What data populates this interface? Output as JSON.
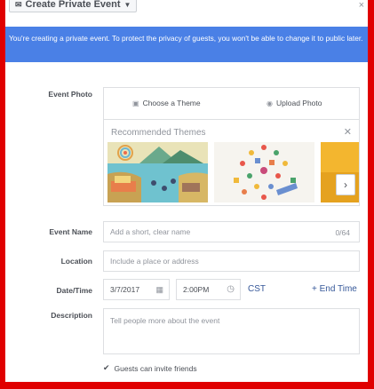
{
  "header": {
    "title": "Create Private Event",
    "title_icon": "envelope-icon",
    "dropdown_icon": "caret-down-icon",
    "close_glyph": "×"
  },
  "notice": {
    "text": "You're creating a private event. To protect the privacy of guests, you won't be able to change it to public later."
  },
  "event_photo": {
    "label": "Event Photo",
    "choose_theme": "Choose a Theme",
    "upload_photo": "Upload Photo",
    "recommended_title": "Recommended Themes",
    "themes": [
      "lake-scene-theme",
      "food-pattern-theme",
      "yellow-theme"
    ]
  },
  "event_name": {
    "label": "Event Name",
    "placeholder": "Add a short, clear name",
    "counter": "0/64"
  },
  "location": {
    "label": "Location",
    "placeholder": "Include a place or address"
  },
  "datetime": {
    "label": "Date/Time",
    "date": "3/7/2017",
    "time": "2:00PM",
    "timezone": "CST",
    "end_time": "+ End Time"
  },
  "description": {
    "label": "Description",
    "placeholder": "Tell people more about the event"
  },
  "guests_invite": {
    "label": "Guests can invite friends",
    "checked": true
  },
  "colors": {
    "frame": "#e00000",
    "notice_bg": "#4a80e6",
    "link": "#365899"
  }
}
